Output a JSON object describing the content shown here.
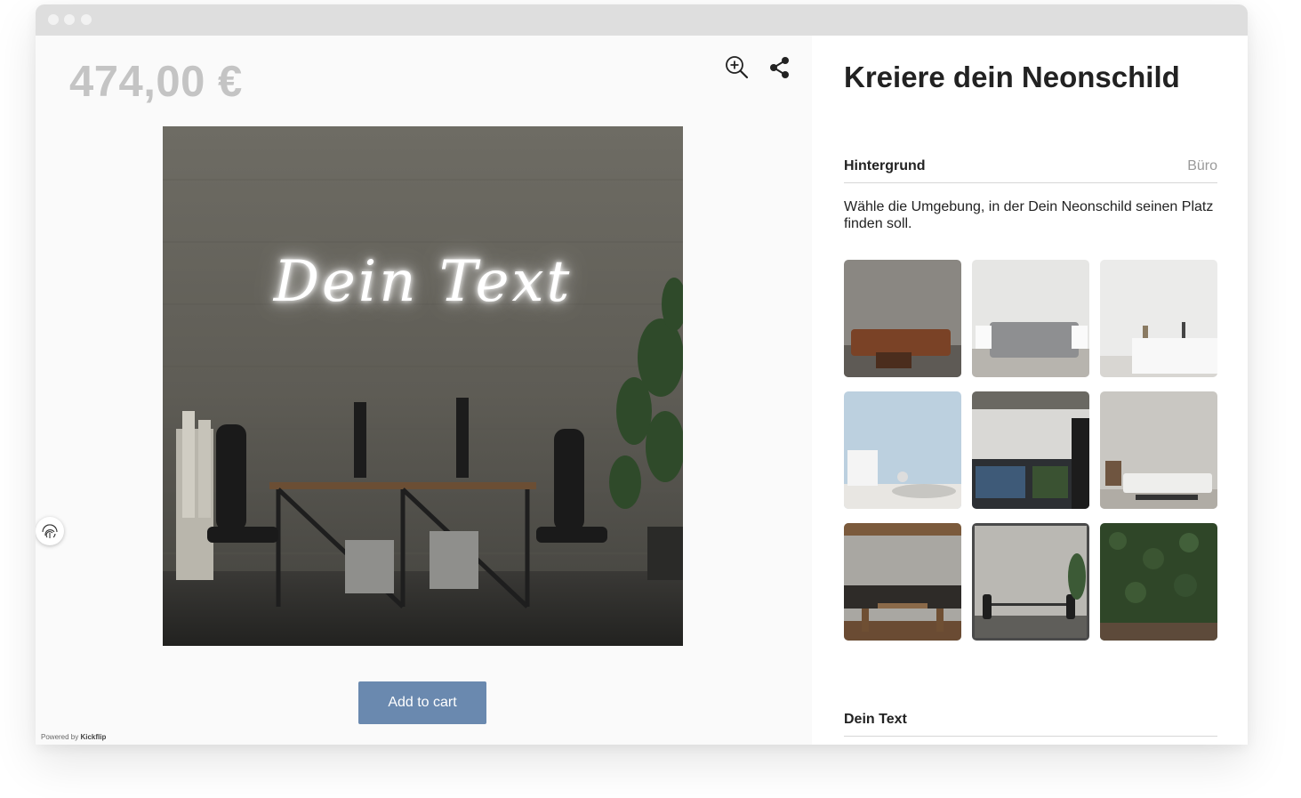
{
  "product": {
    "price": "474,00 €",
    "preview_text": "Dein Text",
    "add_to_cart_label": "Add to cart",
    "powered_by": "Powered by",
    "powered_brand": "Kickflip"
  },
  "toolbar": {
    "zoom_icon": "zoom-in-icon",
    "share_icon": "share-icon"
  },
  "panel": {
    "title": "Kreiere dein Neonschild",
    "sections": [
      {
        "label": "Hintergrund",
        "value": "Büro",
        "description": "Wähle die Umgebung, in der Dein Neonschild seinen Platz finden soll."
      },
      {
        "label": "Dein Text",
        "value": ""
      }
    ],
    "backgrounds": [
      {
        "id": "concrete-sofa",
        "selected": false
      },
      {
        "id": "bedroom",
        "selected": false
      },
      {
        "id": "kitchen",
        "selected": false
      },
      {
        "id": "kids-room",
        "selected": false
      },
      {
        "id": "workshop",
        "selected": false
      },
      {
        "id": "living-room",
        "selected": false
      },
      {
        "id": "restaurant",
        "selected": false
      },
      {
        "id": "office",
        "selected": true
      },
      {
        "id": "green-wall",
        "selected": false
      }
    ]
  },
  "colors": {
    "accent": "#6a89af",
    "price": "#c4c4c4",
    "selected_border": "#4a4a4a"
  }
}
